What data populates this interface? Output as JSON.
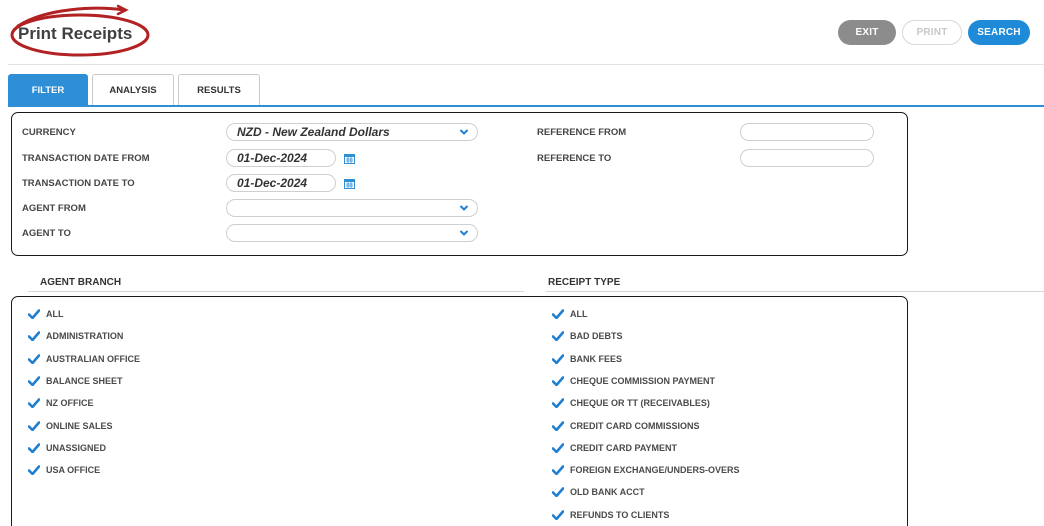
{
  "page": {
    "title": "Print Receipts"
  },
  "toolbar": {
    "exit_label": "EXIT",
    "print_label": "PRINT",
    "search_label": "SEARCH"
  },
  "tabs": [
    {
      "label": "FILTER",
      "active": true
    },
    {
      "label": "ANALYSIS",
      "active": false
    },
    {
      "label": "RESULTS",
      "active": false
    }
  ],
  "filter": {
    "currency": {
      "label": "CURRENCY",
      "value": "NZD - New Zealand Dollars"
    },
    "date_from": {
      "label": "TRANSACTION DATE FROM",
      "value": "01-Dec-2024"
    },
    "date_to": {
      "label": "TRANSACTION DATE TO",
      "value": "01-Dec-2024"
    },
    "agent_from": {
      "label": "AGENT FROM",
      "value": ""
    },
    "agent_to": {
      "label": "AGENT TO",
      "value": ""
    },
    "reference_from": {
      "label": "REFERENCE FROM",
      "value": ""
    },
    "reference_to": {
      "label": "REFERENCE TO",
      "value": ""
    }
  },
  "agent_branch": {
    "heading": "AGENT BRANCH",
    "items": [
      {
        "label": "ALL",
        "checked": true
      },
      {
        "label": "ADMINISTRATION",
        "checked": true
      },
      {
        "label": "AUSTRALIAN OFFICE",
        "checked": true
      },
      {
        "label": "BALANCE SHEET",
        "checked": true
      },
      {
        "label": "NZ OFFICE",
        "checked": true
      },
      {
        "label": "ONLINE SALES",
        "checked": true
      },
      {
        "label": "UNASSIGNED",
        "checked": true
      },
      {
        "label": "USA OFFICE",
        "checked": true
      }
    ]
  },
  "receipt_type": {
    "heading": "RECEIPT TYPE",
    "items": [
      {
        "label": "ALL",
        "checked": true
      },
      {
        "label": "BAD DEBTS",
        "checked": true
      },
      {
        "label": "BANK FEES",
        "checked": true
      },
      {
        "label": "CHEQUE COMMISSION PAYMENT",
        "checked": true
      },
      {
        "label": "CHEQUE OR TT (RECEIVABLES)",
        "checked": true
      },
      {
        "label": "CREDIT CARD COMMISSIONS",
        "checked": true
      },
      {
        "label": "CREDIT CARD PAYMENT",
        "checked": true
      },
      {
        "label": "FOREIGN EXCHANGE/UNDERS-OVERS",
        "checked": true
      },
      {
        "label": "OLD BANK ACCT",
        "checked": true
      },
      {
        "label": "REFUNDS TO CLIENTS",
        "checked": true
      }
    ]
  },
  "colors": {
    "accent": "#2e8fd6",
    "annotation_red": "#b22222",
    "check_blue": "#1f7fd0"
  }
}
